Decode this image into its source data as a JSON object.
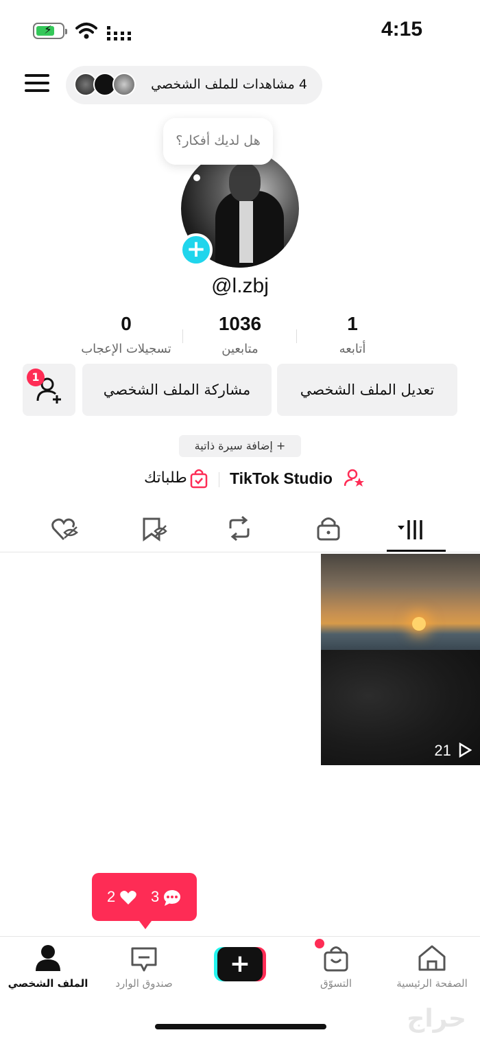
{
  "status_bar": {
    "time": "4:15"
  },
  "header": {
    "views_text": "4 مشاهدات للملف الشخصي",
    "bubble_text": "هل لديك أفكار؟"
  },
  "profile": {
    "username": "@l.zbj",
    "stats": [
      {
        "value": "0",
        "label": "تسجيلات الإعجاب"
      },
      {
        "value": "1036",
        "label": "متابعين"
      },
      {
        "value": "1",
        "label": "أتابعه"
      }
    ],
    "buttons": {
      "edit": "تعديل الملف الشخصي",
      "share": "مشاركة الملف الشخصي",
      "add_friend_badge": "1"
    },
    "bio_add": "+ إضافة سيرة ذاتية",
    "studio": "TikTok Studio",
    "orders": "طلباتك"
  },
  "video": {
    "plays": "21"
  },
  "notification": {
    "likes": "2",
    "comments": "3"
  },
  "nav": {
    "home": "الصفحة الرئيسية",
    "shop": "التسوّق",
    "inbox": "صندوق الوارد",
    "profile": "الملف الشخصي"
  },
  "watermark": "حراج",
  "colors": {
    "accent": "#fe2c55",
    "cyan": "#25f4ee",
    "plus_badge": "#20d5ec"
  }
}
